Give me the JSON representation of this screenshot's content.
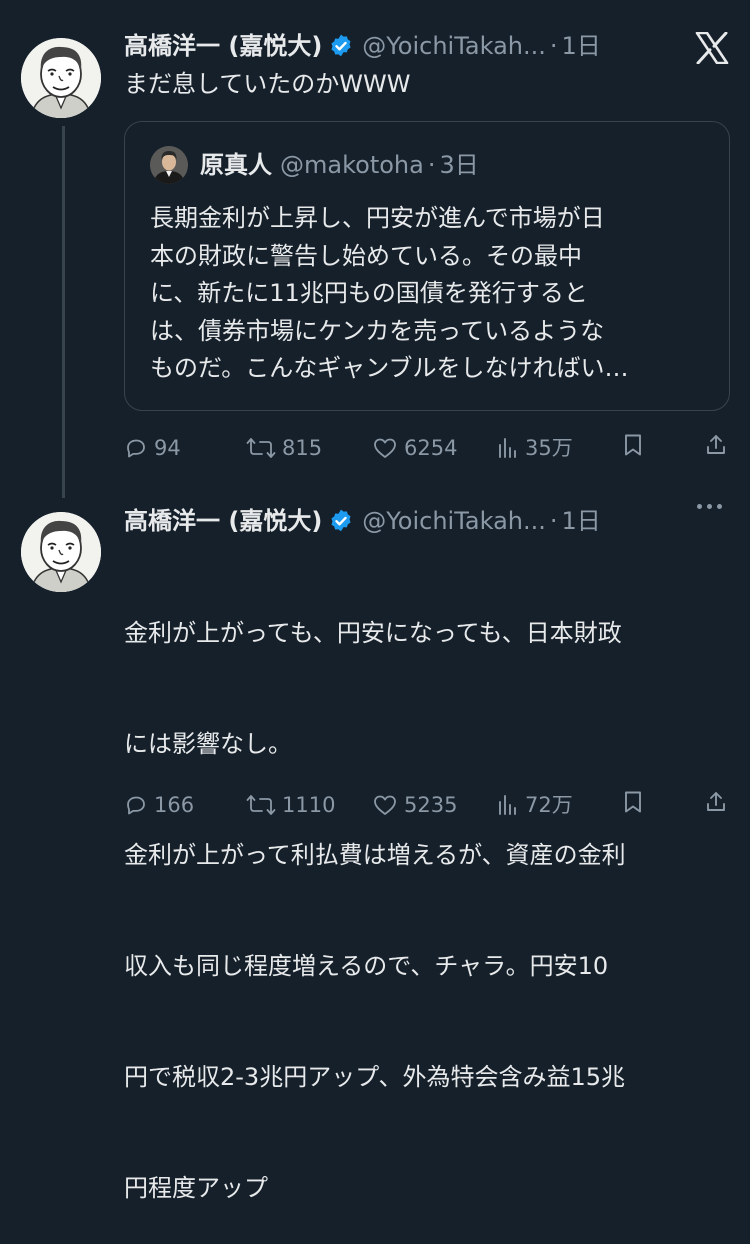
{
  "colors": {
    "background": "#15202b",
    "text": "#e7e9ea",
    "muted": "#8b98a5",
    "verified": "#1d9bf0",
    "border": "#38444d"
  },
  "tweet1": {
    "display_name": "高橋洋一 (嘉悦大)",
    "handle": "@YoichiTakah...",
    "separator": "·",
    "time": "1日",
    "text": "まだ息していたのかWWW",
    "quote": {
      "display_name": "原真人",
      "handle": "@makotoha",
      "separator": "·",
      "time": "3日",
      "lines": [
        "長期金利が上昇し、円安が進んで市場が日",
        "本の財政に警告し始めている。その最中",
        "に、新たに11兆円もの国債を発行すると",
        "は、債券市場にケンカを売っているような",
        "ものだ。こんなギャンブルをしなければい…"
      ]
    },
    "actions": {
      "replies": "94",
      "retweets": "815",
      "likes": "6254",
      "views": "35万"
    }
  },
  "tweet2": {
    "display_name": "高橋洋一 (嘉悦大)",
    "handle": "@YoichiTakah...",
    "separator": "·",
    "time": "1日",
    "lines": [
      "金利が上がっても、円安になっても、日本財政",
      "には影響なし。",
      "金利が上がって利払費は増えるが、資産の金利",
      "収入も同じ程度増えるので、チャラ。円安10",
      "円で税収2-3兆円アップ、外為特会含み益15兆",
      "円程度アップ"
    ],
    "actions": {
      "replies": "166",
      "retweets": "1110",
      "likes": "5235",
      "views": "72万"
    }
  }
}
